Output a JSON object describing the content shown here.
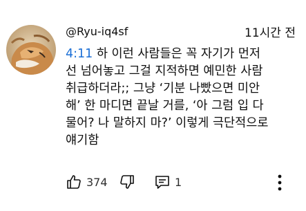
{
  "comment": {
    "author_handle": "@Ryu-iq4sf",
    "posted_ago": "11시간 전",
    "timestamp_link": "4:11",
    "lines": [
      " 하 이런 사람들은 꼭 자기가 먼저",
      "선 넘어놓고 그걸 지적하면 예민한 사람",
      "취급하더라;; 그냥 ‘기분 나빴으면 미안",
      "해’ 한 마디면 끝날 거를, ‘아 그럼 입 다",
      "물어? 나 말하지 마?’ 이렇게 극단적으로",
      "얘기함"
    ]
  },
  "actions": {
    "like_count": "374",
    "reply_count": "1",
    "like_icon": "thumbs-up-icon",
    "dislike_icon": "thumbs-down-icon",
    "reply_icon": "reply-comment-icon",
    "more_icon": "more-vertical-icon"
  },
  "colors": {
    "text": "#0f0f0f",
    "link": "#1b6fd6",
    "secondary": "#303030",
    "background": "#ffffff"
  }
}
